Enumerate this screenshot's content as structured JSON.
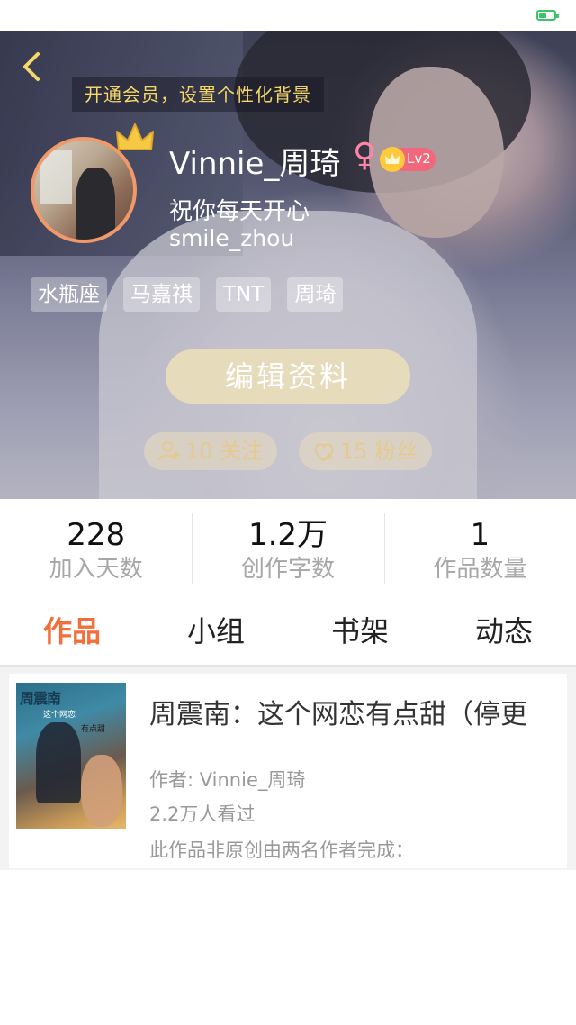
{
  "header": {
    "back_icon": "chevron-left-icon",
    "vip_banner": "开通会员，设置个性化背景",
    "crown_icon": "crown-icon"
  },
  "profile": {
    "username": "Vinnie_周琦",
    "gender_symbol": "♀",
    "level": "Lv2",
    "motto": "祝你每天开心",
    "handle": "smile_zhou",
    "tags": [
      "水瓶座",
      "马嘉祺",
      "TNT",
      "周琦"
    ],
    "edit_button": "编辑资料",
    "following": "10 关注",
    "fans": "15 粉丝"
  },
  "stats": [
    {
      "value": "228",
      "label": "加入天数"
    },
    {
      "value": "1.2万",
      "label": "创作字数"
    },
    {
      "value": "1",
      "label": "作品数量"
    }
  ],
  "tabs": [
    {
      "label": "作品",
      "active": true
    },
    {
      "label": "小组",
      "active": false
    },
    {
      "label": "书架",
      "active": false
    },
    {
      "label": "动态",
      "active": false
    }
  ],
  "works": [
    {
      "title": "周震南：这个网恋有点甜（停更",
      "author": "作者: Vinnie_周琦",
      "views": "2.2万人看过",
      "description": "此作品非原创由两名作者完成：",
      "cover_title": "周震南",
      "cover_sub": "这个网恋",
      "cover_sub2": "有点甜"
    }
  ],
  "colors": {
    "accent": "#f26f3c",
    "vip_text": "#f5d86a",
    "edit_button_bg": "#e6dcbc",
    "avatar_border": "#f0996a",
    "level_badge": "#f2677b"
  }
}
